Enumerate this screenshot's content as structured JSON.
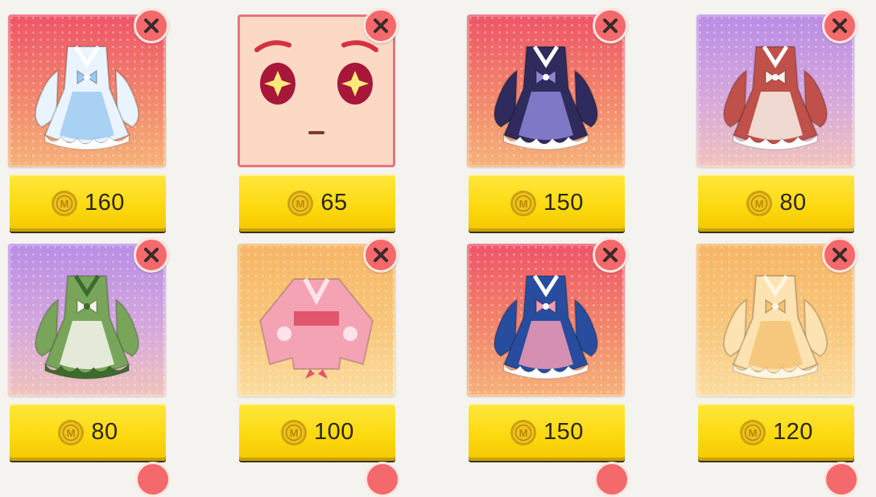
{
  "items": [
    {
      "id": "blue-cloud-dress",
      "price": "160",
      "theme": "red",
      "art": "dress",
      "colors": {
        "main": "#eaf4ff",
        "accent": "#9ccaf2",
        "trim": "#ffffff"
      }
    },
    {
      "id": "star-eyes-face",
      "price": "65",
      "theme": "face",
      "art": "face",
      "colors": {
        "main": "#fbd9c5",
        "accent": "#a8163a",
        "trim": "#d2333f"
      }
    },
    {
      "id": "navy-gothic-dress",
      "price": "150",
      "theme": "red",
      "art": "dress",
      "colors": {
        "main": "#2f2b5c",
        "accent": "#8d86d8",
        "trim": "#ffffff"
      }
    },
    {
      "id": "strawberry-apron-dress",
      "price": "80",
      "theme": "purple",
      "art": "dress",
      "colors": {
        "main": "#c0504a",
        "accent": "#f7f1e8",
        "trim": "#ffffff"
      }
    },
    {
      "id": "green-maid-dress",
      "price": "80",
      "theme": "purple",
      "art": "dress",
      "colors": {
        "main": "#78a55a",
        "accent": "#f8f5ee",
        "trim": "#3d6b2c"
      }
    },
    {
      "id": "pink-kimono",
      "price": "100",
      "theme": "orange",
      "art": "kimono",
      "colors": {
        "main": "#f4a3b4",
        "accent": "#e1566c",
        "trim": "#ffe3ea"
      }
    },
    {
      "id": "blue-lolita-dress",
      "price": "150",
      "theme": "red",
      "art": "dress",
      "colors": {
        "main": "#284c9e",
        "accent": "#f29bb5",
        "trim": "#ffffff"
      }
    },
    {
      "id": "peach-ruffle-dress",
      "price": "120",
      "theme": "orange",
      "art": "dress",
      "colors": {
        "main": "#fde3b2",
        "accent": "#f5c374",
        "trim": "#fff6e2"
      }
    }
  ],
  "colors": {
    "close_bg": "#f4696b",
    "price_bg": "#fdd80d",
    "coin": "#f1c11e",
    "page_bg": "#f4f3ef"
  },
  "icons": {
    "close": "close-icon",
    "coin": "coin-icon"
  }
}
